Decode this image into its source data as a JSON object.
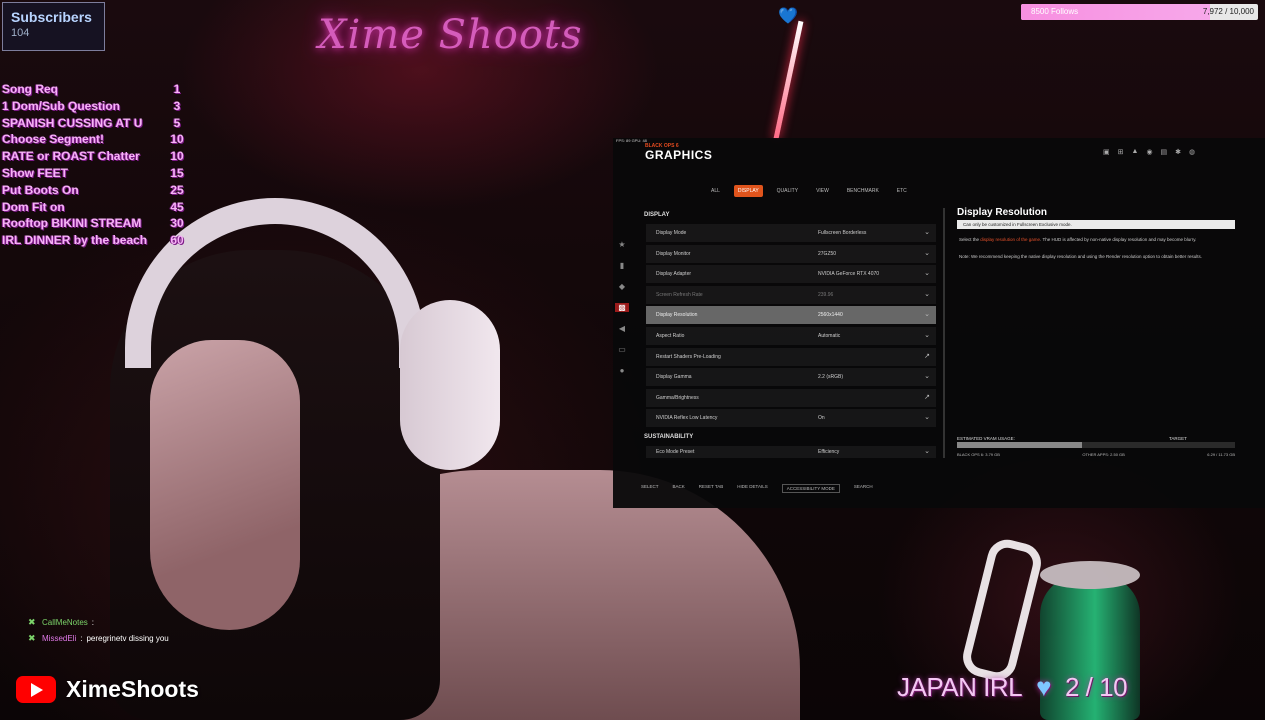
{
  "subscribers": {
    "title": "Subscribers",
    "count": "104"
  },
  "menu": [
    {
      "label": "Song Req",
      "price": "1"
    },
    {
      "label": "1 Dom/Sub Question",
      "price": "3"
    },
    {
      "label": "SPANISH CUSSING AT U",
      "price": "5"
    },
    {
      "label": "Choose Segment!",
      "price": "10"
    },
    {
      "label": "RATE or ROAST Chatter",
      "price": "10"
    },
    {
      "label": "Show FEET",
      "price": "15"
    },
    {
      "label": "Put Boots On",
      "price": "25"
    },
    {
      "label": "Dom Fit on",
      "price": "45"
    },
    {
      "label": "Rooftop BIKINI STREAM",
      "price": "30"
    },
    {
      "label": "IRL DINNER by the beach",
      "price": "60"
    }
  ],
  "follow_goal": {
    "label": "8500 Follows",
    "count": "7,972 / 10,000",
    "fraction": 0.797
  },
  "chat": [
    {
      "user": "CallMeNotes",
      "message": ""
    },
    {
      "user": "MissedEli",
      "message": "peregrinetv dissing you"
    }
  ],
  "channel": {
    "name": "XimeShoots"
  },
  "stream_title": {
    "text": "JAPAN IRL",
    "progress": "2 / 10"
  },
  "neon_sign": "Xime Shoots",
  "game": {
    "fps": "FPS: 89  GPU: 48",
    "subtitle": "BLACK OPS 6",
    "title": "GRAPHICS",
    "tabs": [
      {
        "label": "ALL",
        "active": false
      },
      {
        "label": "DISPLAY",
        "active": true
      },
      {
        "label": "QUALITY",
        "active": false
      },
      {
        "label": "VIEW",
        "active": false
      },
      {
        "label": "BENCHMARK",
        "active": false
      },
      {
        "label": "ETC",
        "active": false
      }
    ],
    "section_display": "DISPLAY",
    "section_sustain": "SUSTAINABILITY",
    "settings": [
      {
        "key": "Display Mode",
        "value": "Fullscreen Borderless",
        "state": ""
      },
      {
        "key": "Display Monitor",
        "value": "27GZ50",
        "state": ""
      },
      {
        "key": "Display Adapter",
        "value": "NVIDIA GeForce RTX 4070",
        "state": ""
      },
      {
        "key": "Screen Refresh Rate",
        "value": "239.96",
        "state": "dim"
      },
      {
        "key": "Display Resolution",
        "value": "2560x1440",
        "state": "hl"
      },
      {
        "key": "Aspect Ratio",
        "value": "Automatic",
        "state": ""
      },
      {
        "key": "Restart Shaders Pre-Loading",
        "value": "",
        "state": ""
      },
      {
        "key": "Display Gamma",
        "value": "2.2 (sRGB)",
        "state": ""
      },
      {
        "key": "Gamma/Brightness",
        "value": "",
        "state": ""
      },
      {
        "key": "NVIDIA Reflex Low Latency",
        "value": "On",
        "state": ""
      }
    ],
    "eco_mode": {
      "key": "Eco Mode Preset",
      "value": "Efficiency"
    },
    "right_title": "Display Resolution",
    "right_note": "Can only be customized in Fullscreen Exclusive mode.",
    "right_desc_pre": "Select the ",
    "right_desc_hl": "display resolution of the game",
    "right_desc_post": ". The HUD is affected by non-native display resolution and may become blurry.",
    "right_desc2": "Note: We recommend keeping the native display resolution and using the Render resolution option to obtain better results.",
    "vram_label": "ESTIMATED VRAM USAGE:",
    "vram_target": "TARGET",
    "vram_fraction": 0.45,
    "vram_row": [
      "BLACK OPS 6: 3.79 GB",
      "OTHER APPS: 2.50 GB",
      "6.29 / 11.73 GB"
    ],
    "bottom": [
      "SELECT",
      "BACK",
      "RESET TAB",
      "HIDE DETAILS",
      "ACCESSIBILITY MODE",
      "SEARCH"
    ]
  }
}
